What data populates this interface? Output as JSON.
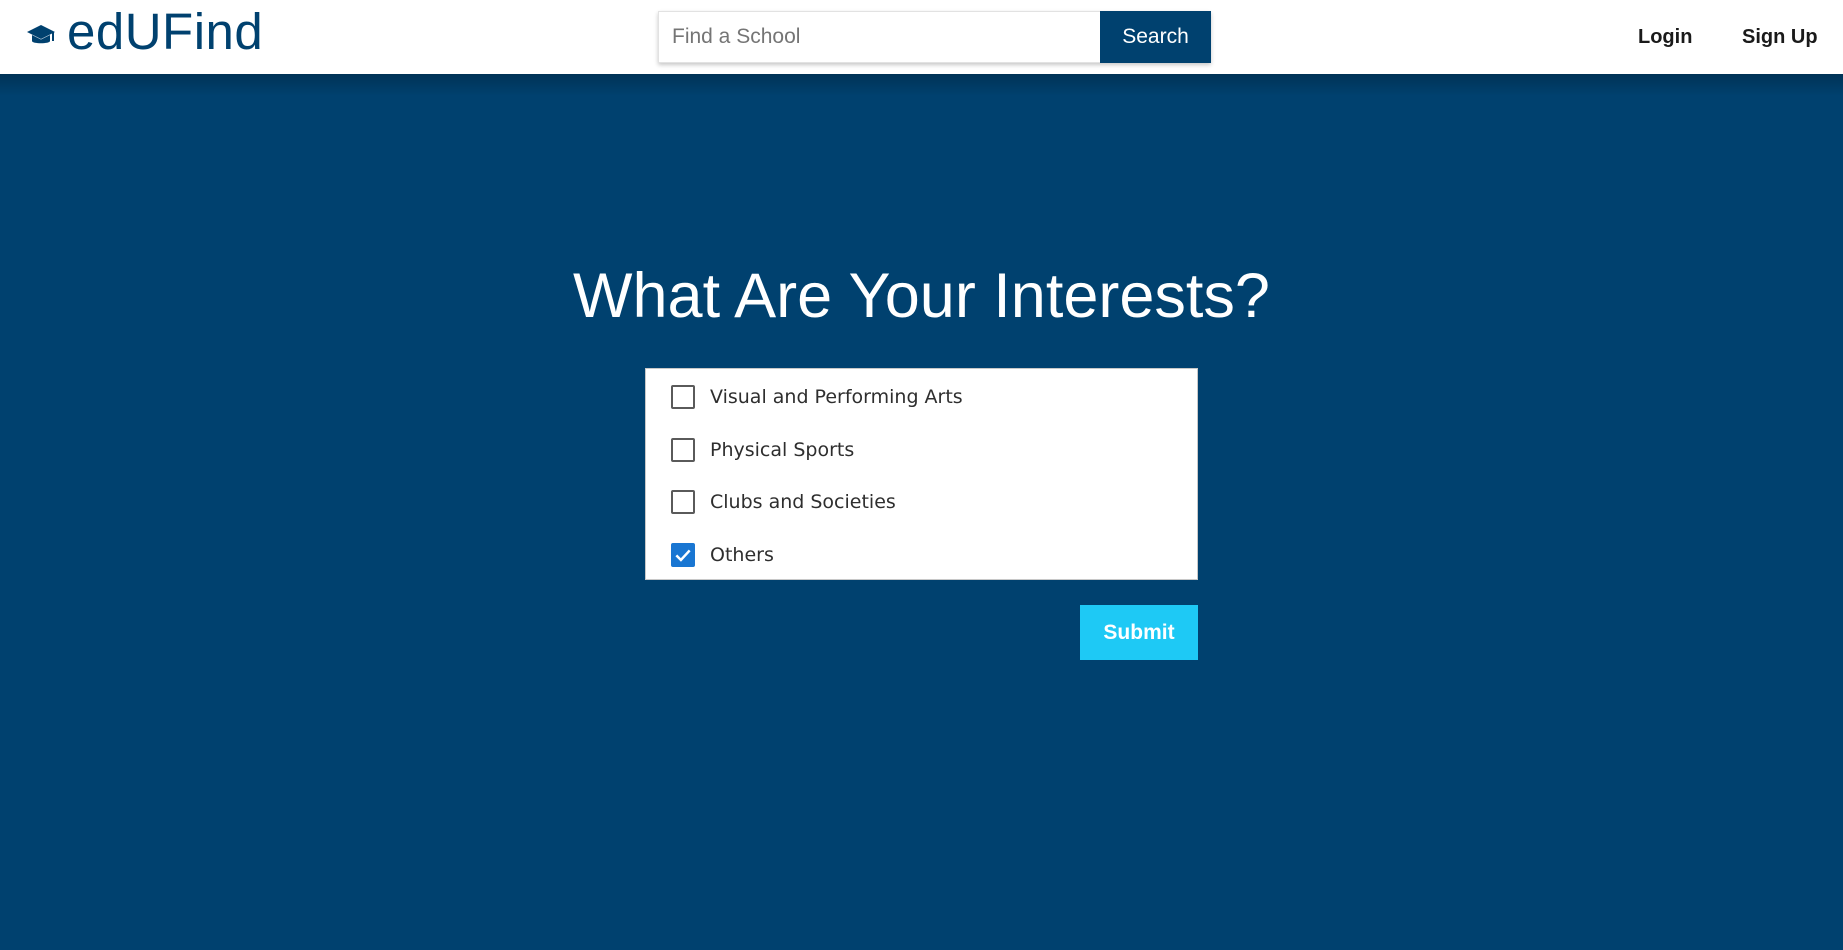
{
  "header": {
    "brand_name": "edUFind",
    "brand_icon": "graduation-cap-icon",
    "search": {
      "placeholder": "Find a School",
      "value": "",
      "button_label": "Search"
    },
    "nav": {
      "login_label": "Login",
      "signup_label": "Sign Up"
    }
  },
  "main": {
    "title": "What Are Your Interests?",
    "interests": [
      {
        "label": "Visual and Performing Arts",
        "checked": false
      },
      {
        "label": "Physical Sports",
        "checked": false
      },
      {
        "label": "Clubs and Societies",
        "checked": false
      },
      {
        "label": "Others",
        "checked": true
      }
    ],
    "submit_label": "Submit"
  },
  "colors": {
    "brand_navy": "#00416f",
    "header_background": "#ffffff",
    "submit_cyan": "#1ec9f5",
    "checkbox_checked": "#1976d2"
  }
}
